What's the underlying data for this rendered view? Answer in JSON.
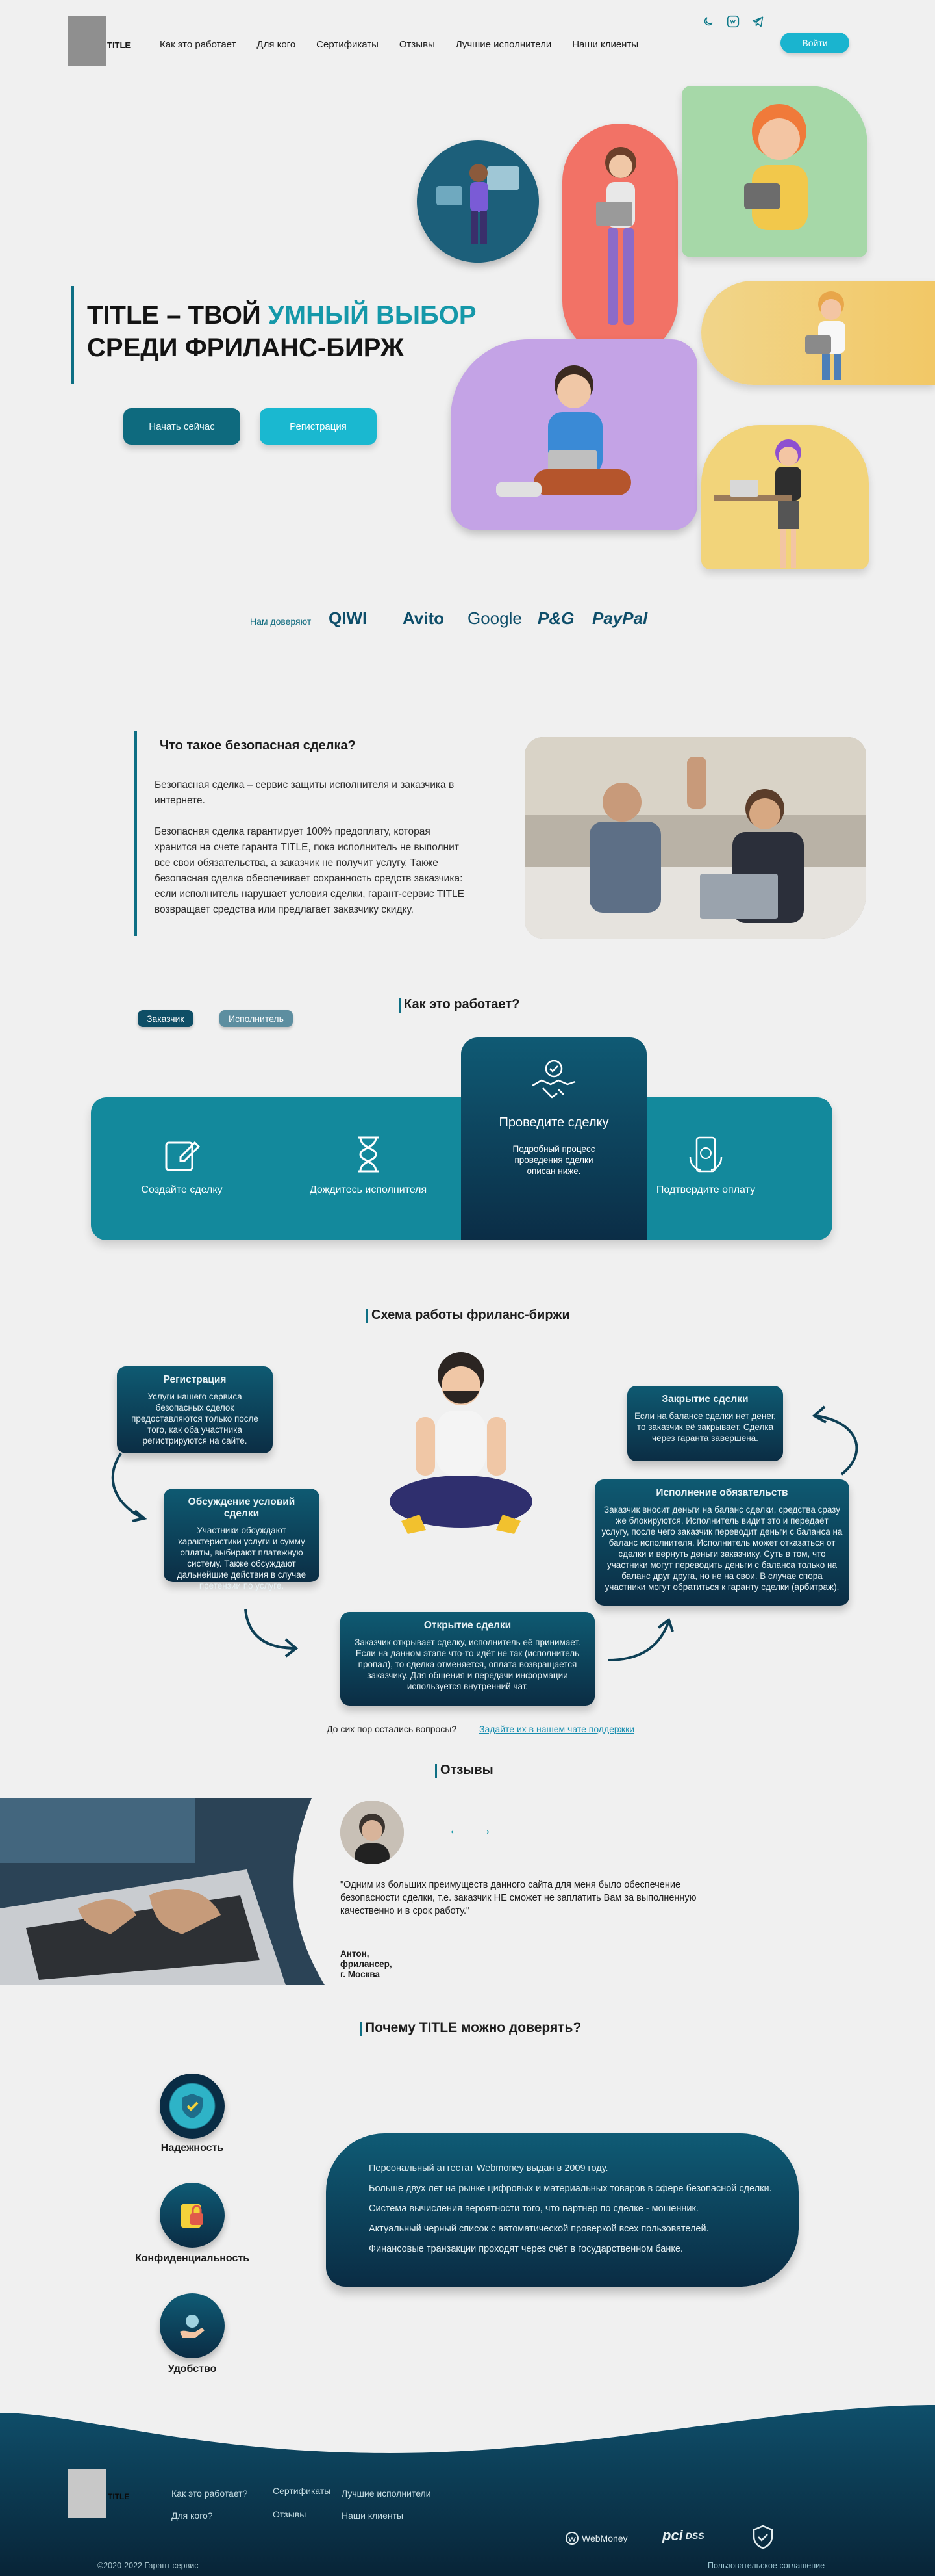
{
  "header": {
    "logo": "TITLE",
    "nav": [
      "Как это работает",
      "Для кого",
      "Сертификаты",
      "Отзывы",
      "Лучшие исполнители",
      "Наши клиенты"
    ],
    "login": "Войти"
  },
  "hero": {
    "title_part1": "TITLE – ТВОЙ ",
    "title_accent": "УМНЫЙ ВЫБОР",
    "title_part2": "СРЕДИ ФРИЛАНС-БИРЖ",
    "btn_start": "Начать сейчас",
    "btn_register": "Регистрация"
  },
  "trust": {
    "label": "Нам доверяют",
    "brands": [
      "QIWI",
      "Avito",
      "Google",
      "P&G",
      "PayPal"
    ]
  },
  "safe_deal": {
    "title": "Что такое безопасная сделка?",
    "p1": "Безопасная сделка – сервис защиты исполнителя и заказчика в интернете.",
    "p2": "Безопасная сделка гарантирует 100% предоплату, которая хранится на счете гаранта TITLE, пока исполнитель не выполнит все свои обязательства, а заказчик не получит услугу. Также безопасная сделка обеспечивает сохранность средств заказчика: если исполнитель нарушает условия сделки, гарант-сервис TITLE возвращает средства или предлагает заказчику скидку."
  },
  "how": {
    "title": "Как это работает?",
    "tab_customer": "Заказчик",
    "tab_executor": "Исполнитель",
    "step1": "Создайте сделку",
    "step2": "Дождитесь исполнителя",
    "step3_title": "Проведите сделку",
    "step3_text": "Подробный процесс проведения сделки описан ниже.",
    "step4": "Подтвердите оплату"
  },
  "scheme": {
    "title": "Схема работы фриланс-биржи",
    "cards": [
      {
        "title": "Регистрация",
        "text": "Услуги нашего сервиса безопасных сделок предоставляются только после того, как оба участника регистрируются на сайте."
      },
      {
        "title": "Обсуждение условий сделки",
        "text": "Участники обсуждают характеристики услуги и сумму оплаты, выбирают платежную систему. Также обсуждают дальнейшие действия в случае претензии по услуге."
      },
      {
        "title": "Открытие сделки",
        "text": "Заказчик открывает сделку, исполнитель её принимает. Если на данном этапе что-то идёт не так (исполнитель пропал), то сделка отменяется, оплата возвращается заказчику. Для общения и передачи информации используется внутренний чат."
      },
      {
        "title": "Исполнение обязательств",
        "text": "Заказчик вносит деньги на баланс сделки, средства сразу же блокируются. Исполнитель видит это и передаёт услугу, после чего заказчик переводит деньги с баланса на баланс исполнителя. Исполнитель может отказаться от сделки и вернуть деньги заказчику. Суть в том, что участники могут переводить деньги с баланса только на баланс друг друга, но не на свои. В случае спора участники могут обратиться к гаранту сделки (арбитраж)."
      },
      {
        "title": "Закрытие сделки",
        "text": "Если на балансе сделки нет денег, то заказчик её закрывает. Сделка через гаранта завершена."
      }
    ],
    "question": "До сих пор остались вопросы?",
    "question_link": "Задайте их в нашем чате поддержки"
  },
  "reviews": {
    "title": "Отзывы",
    "quote": "\"Одним из больших преимуществ данного сайта для меня было обеспечение безопасности сделки, т.е. заказчик НЕ сможет не заплатить Вам за выполненную качественно и в срок работу.\"",
    "author_name": "Антон,",
    "author_role": "фрилансер,",
    "author_city": "г. Москва"
  },
  "why": {
    "title": "Почему TITLE  можно доверять?",
    "items": [
      "Надежность",
      "Конфиденциальность",
      "Удобство"
    ],
    "facts": [
      "Персональный аттестат Webmoney выдан в 2009 году.",
      "Больше двух лет на рынке цифровых и материальных товаров в сфере безопасной сделки.",
      "Система вычисления вероятности того, что партнер по сделке - мошенник.",
      "Актуальный черный список с автоматической проверкой всех пользователей.",
      "Финансовые транзакции проходят через счёт в государственном банке."
    ]
  },
  "footer": {
    "logo": "TITLE",
    "links_col1": [
      "Как это работает?",
      "Для кого?"
    ],
    "links_col2": [
      "Сертификаты",
      "Отзывы"
    ],
    "links_col3": [
      "Лучшие исполнители",
      "Наши клиенты"
    ],
    "pay1": "WebMoney",
    "pay2": "DSS",
    "copyright": "©2020-2022 Гарант сервис",
    "agreement": "Пользовательское соглашение"
  },
  "colors": {
    "accent": "#1598a9",
    "dark": "#0b2d44",
    "teal": "#13899c"
  }
}
